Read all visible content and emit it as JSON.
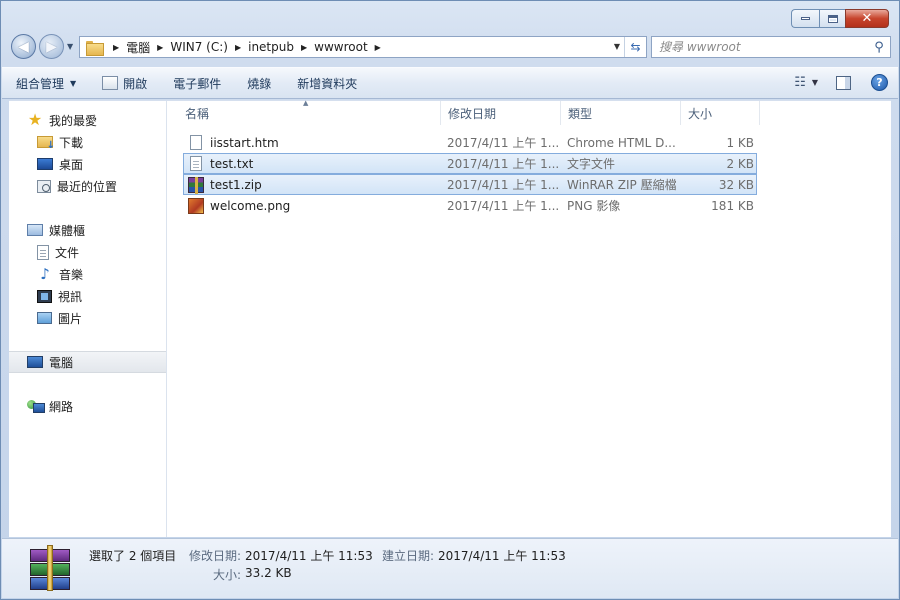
{
  "window": {
    "min_label": "minimize",
    "max_label": "maximize",
    "close_glyph": "✕"
  },
  "address": {
    "crumbs": [
      "電腦",
      "WIN7 (C:)",
      "inetpub",
      "wwwroot"
    ],
    "search_placeholder": "搜尋 wwwroot"
  },
  "toolbar": {
    "organize": "組合管理",
    "open": "開啟",
    "email": "電子郵件",
    "burn": "燒錄",
    "new_folder": "新增資料夾"
  },
  "sidebar": {
    "favorites": "我的最愛",
    "downloads": "下載",
    "desktop": "桌面",
    "recent": "最近的位置",
    "libraries": "媒體櫃",
    "documents": "文件",
    "music": "音樂",
    "videos": "視訊",
    "pictures": "圖片",
    "computer": "電腦",
    "network": "網路"
  },
  "columns": {
    "name": "名稱",
    "date": "修改日期",
    "type": "類型",
    "size": "大小"
  },
  "files": [
    {
      "name": "iisstart.htm",
      "date": "2017/4/11 上午 1...",
      "type": "Chrome HTML D...",
      "size": "1 KB",
      "icon": "html-file-icon",
      "selected": false
    },
    {
      "name": "test.txt",
      "date": "2017/4/11 上午 1...",
      "type": "文字文件",
      "size": "2 KB",
      "icon": "text-file-icon",
      "selected": true
    },
    {
      "name": "test1.zip",
      "date": "2017/4/11 上午 1...",
      "type": "WinRAR ZIP 壓縮檔",
      "size": "32 KB",
      "icon": "winrar-zip-icon",
      "selected": true
    },
    {
      "name": "welcome.png",
      "date": "2017/4/11 上午 1...",
      "type": "PNG 影像",
      "size": "181 KB",
      "icon": "png-image-icon",
      "selected": false
    }
  ],
  "details": {
    "summary": "選取了 2 個項目",
    "modified_label": "修改日期:",
    "modified_value": "2017/4/11 上午 11:53",
    "created_label": "建立日期:",
    "created_value": "2017/4/11 上午 11:53",
    "size_label": "大小:",
    "size_value": "33.2 KB"
  },
  "colors": {
    "selection_fill": "#d2e4f7",
    "selection_border": "#84acdd",
    "close_button": "#c7442c"
  }
}
